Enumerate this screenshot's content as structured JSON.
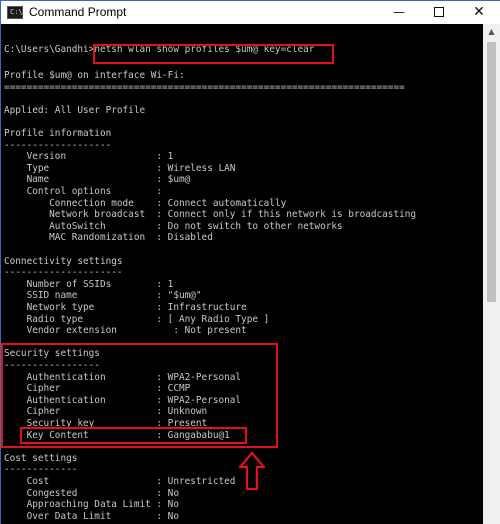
{
  "window": {
    "title": "Command Prompt",
    "icon": "console-icon",
    "controls": [
      "minimize",
      "maximize",
      "close"
    ]
  },
  "console": {
    "prompt": "C:\\Users\\Gandhi>",
    "command": "netsh wlan show profiles $um@ key=clear",
    "lines": [
      "Profile $um@ on interface Wi-Fi:",
      "=======================================================================",
      "",
      "Applied: All User Profile",
      "",
      "Profile information",
      "-------------------",
      "    Version                : 1",
      "    Type                   : Wireless LAN",
      "    Name                   : $um@",
      "    Control options        :",
      "        Connection mode    : Connect automatically",
      "        Network broadcast  : Connect only if this network is broadcasting",
      "        AutoSwitch         : Do not switch to other networks",
      "        MAC Randomization  : Disabled",
      "",
      "Connectivity settings",
      "---------------------",
      "    Number of SSIDs        : 1",
      "    SSID name              : \"$um@\"",
      "    Network type           : Infrastructure",
      "    Radio type             : [ Any Radio Type ]",
      "    Vendor extension          : Not present",
      "",
      "Security settings",
      "-----------------",
      "    Authentication         : WPA2-Personal",
      "    Cipher                 : CCMP",
      "    Authentication         : WPA2-Personal",
      "    Cipher                 : Unknown",
      "    Security key           : Present",
      "    Key Content            : Gangababu@1",
      "",
      "Cost settings",
      "-------------",
      "    Cost                   : Unrestricted",
      "    Congested              : No",
      "    Approaching Data Limit : No",
      "    Over Data Limit        : No"
    ]
  },
  "colors": {
    "background": "#000000",
    "text": "#c8c8c8",
    "highlight": "#e0111d"
  }
}
